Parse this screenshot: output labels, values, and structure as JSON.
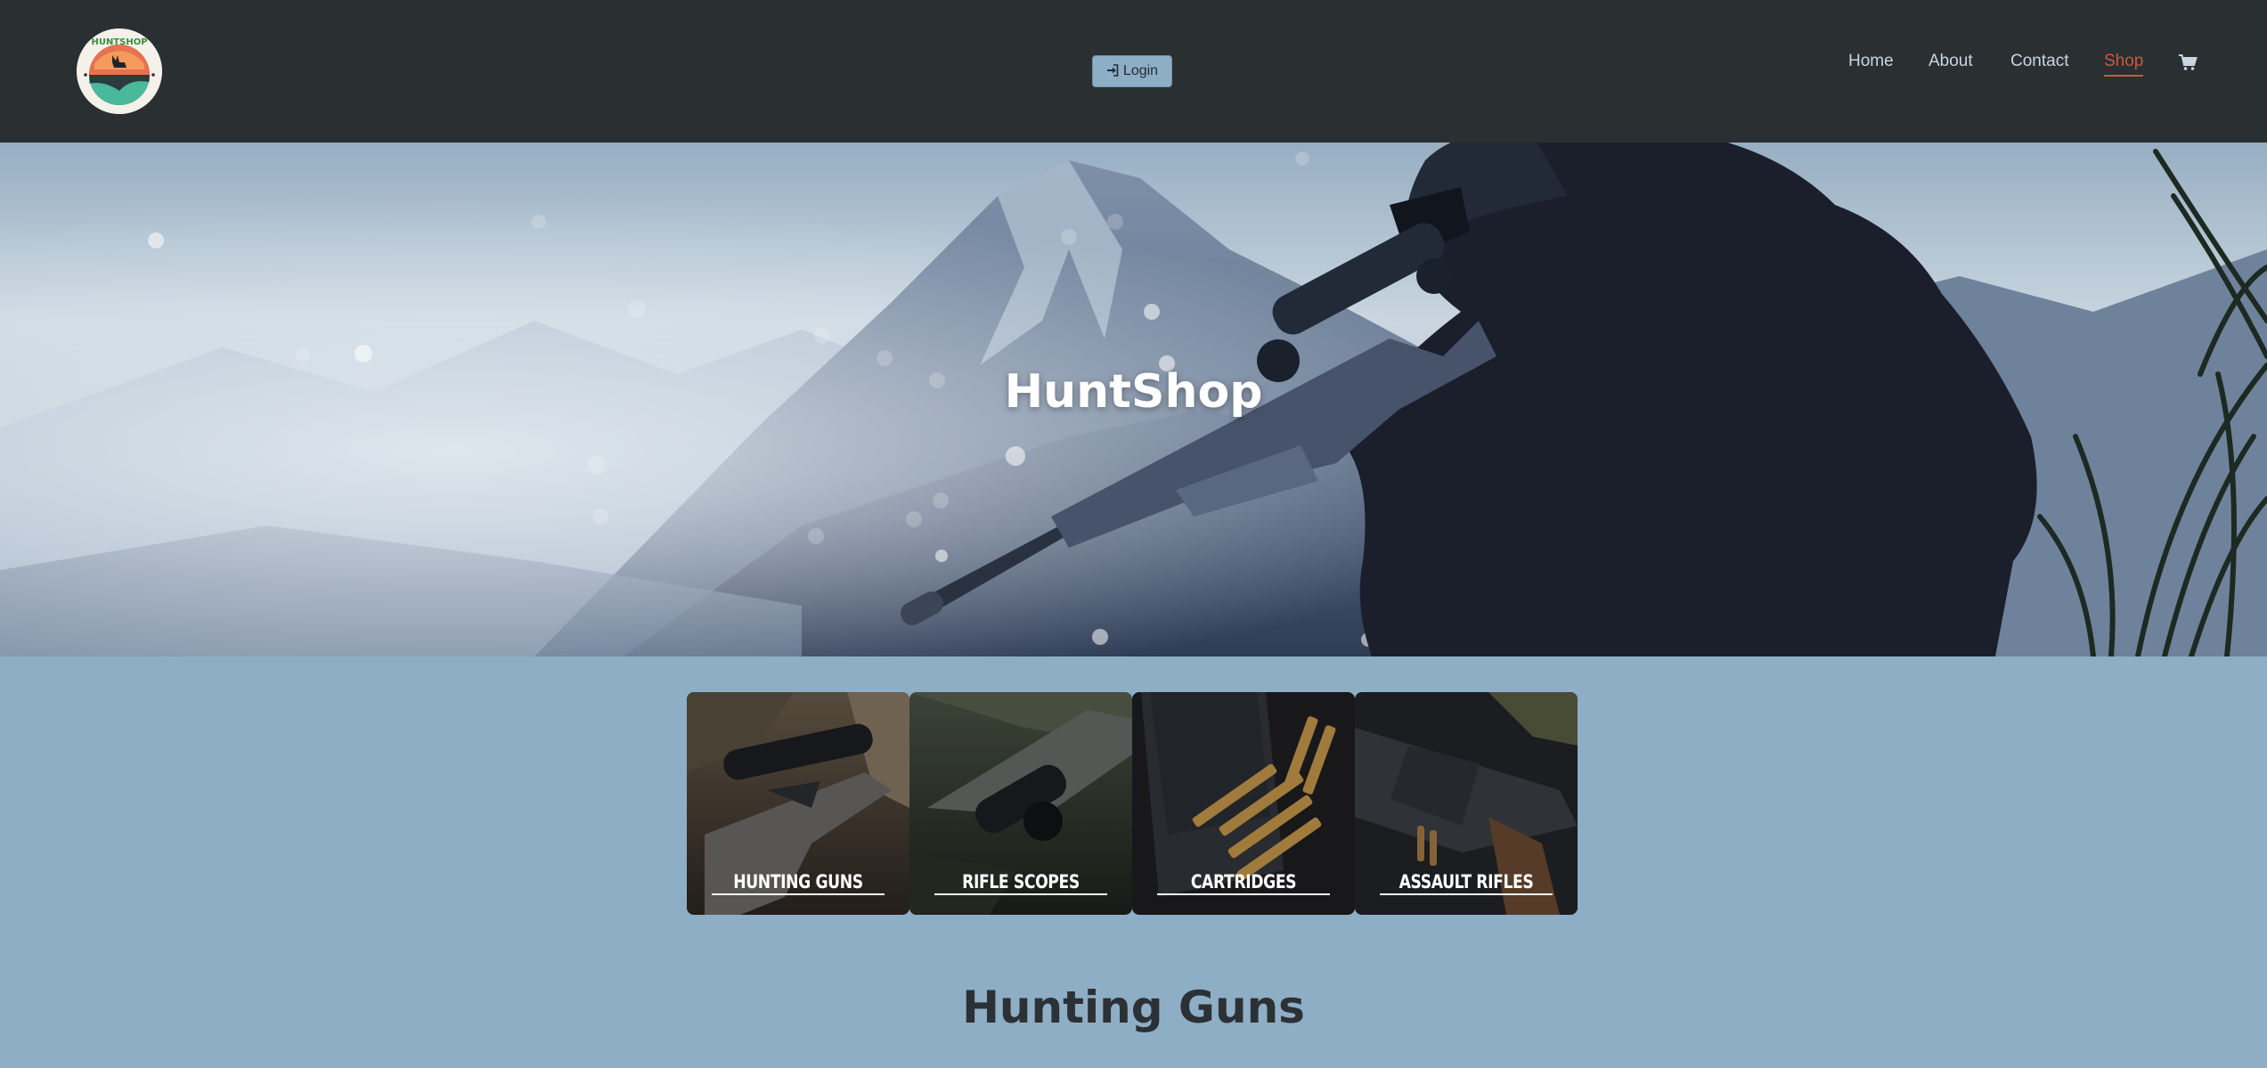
{
  "brand": {
    "logo_text": "HUNTSHOP"
  },
  "header": {
    "login_label": "Login",
    "nav": [
      {
        "label": "Home"
      },
      {
        "label": "About"
      },
      {
        "label": "Contact"
      },
      {
        "label": "Shop",
        "active": true
      }
    ]
  },
  "hero": {
    "title": "HuntShop"
  },
  "categories": [
    {
      "label": "HUNTING GUNS"
    },
    {
      "label": "RIFLE SCOPES"
    },
    {
      "label": "CARTRIDGES"
    },
    {
      "label": "ASSAULT RIFLES"
    }
  ],
  "section": {
    "title": "Hunting Guns"
  },
  "colors": {
    "navbar_bg": "#2a2f31",
    "page_bg": "#8eaec6",
    "nav_text": "#c7d6e1",
    "nav_active": "#c9583f",
    "login_bg": "#8eaec6"
  }
}
